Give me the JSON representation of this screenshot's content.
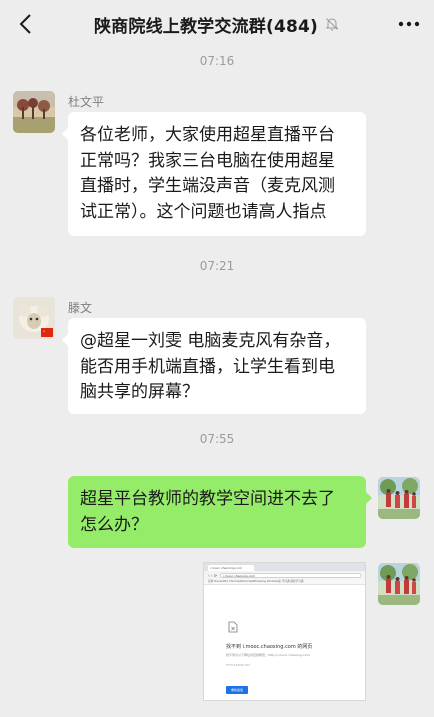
{
  "header": {
    "title": "陕商院线上教学交流群(484)"
  },
  "messages": [
    {
      "time": "07:16",
      "sender": "杜文平",
      "lines": [
        "各位老师，大家使用超星直播平台",
        "正常吗？我家三台电脑在使用超星",
        "直播时，学生端没声音（麦克风测",
        "试正常）。这个问题也请高人指点"
      ]
    },
    {
      "time": "07:21",
      "sender": "滕文",
      "lines": [
        "@超星一刘雯  电脑麦克风有杂音，",
        "能否用手机端直播，让学生看到电",
        "脑共享的屏幕？"
      ]
    },
    {
      "time": "07:55",
      "lines": [
        "超星平台教师的教学空间进不去了",
        "怎么办？"
      ]
    }
  ],
  "screenshot": {
    "tab_label": "i.mooc.chaoxing.com",
    "url": "i.mooc.chaoxing.com",
    "bookmarks": "应用   TencentPro   Chrome/Robot   SafeBrowsing   Windows业   学习通   超星学习通",
    "error_title": "找不到 i.mooc.chaoxing.com 的网页",
    "error_desc": "找不到与以下网址对应的网页：http://i.mooc.chaoxing.com/",
    "error_code": "HTTP ERROR 404",
    "reload_label": "重新加载"
  },
  "colors": {
    "background": "#ededed",
    "bubble_in": "#ffffff",
    "bubble_out": "#95ec69"
  }
}
